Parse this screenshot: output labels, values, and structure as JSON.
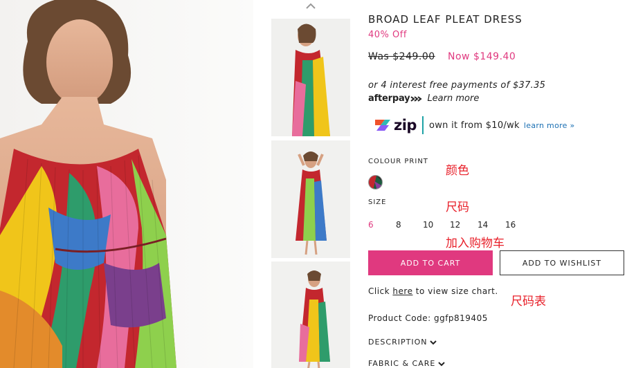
{
  "thumbnails": [
    {
      "name": "thumbnail-1"
    },
    {
      "name": "thumbnail-2"
    },
    {
      "name": "thumbnail-3"
    }
  ],
  "product": {
    "title": "BROAD LEAF PLEAT DRESS",
    "discount": "40% Off",
    "was_price": "Was $249.00",
    "now_price": "Now $149.40"
  },
  "afterpay": {
    "installments_text": "or 4 interest free payments of $37.35",
    "logo_text_after": "after",
    "logo_text_pay": "pay",
    "learn_more": "Learn more"
  },
  "zip": {
    "logo_text": "zip",
    "own_text": "own it from $10/wk",
    "learn_more": "learn more »"
  },
  "colour": {
    "label": "COLOUR PRINT",
    "annotation": "颜色"
  },
  "size": {
    "label": "SIZE",
    "annotation": "尺码",
    "options": [
      "6",
      "8",
      "10",
      "12",
      "14",
      "16"
    ],
    "selected": "6"
  },
  "cart": {
    "annotation": "加入购物车",
    "add_to_cart": "ADD TO CART",
    "add_to_wishlist": "ADD TO WISHLIST"
  },
  "size_chart": {
    "prefix": "Click ",
    "link": "here",
    "suffix": " to view size chart.",
    "annotation": "尺码表"
  },
  "product_code": "Product Code: ggfp819405",
  "accordions": {
    "description": "DESCRIPTION",
    "fabric_care": "FABRIC & CARE"
  },
  "colors": {
    "accent_pink": "#e0397f",
    "annotation_red": "#e8202a",
    "zip_teal": "#1da2a6",
    "link_blue": "#1a6fb3"
  },
  "icons": [
    "chevron-up-icon",
    "afterpay-arrows-icon",
    "zip-logo-icon",
    "chevron-down-icon"
  ]
}
